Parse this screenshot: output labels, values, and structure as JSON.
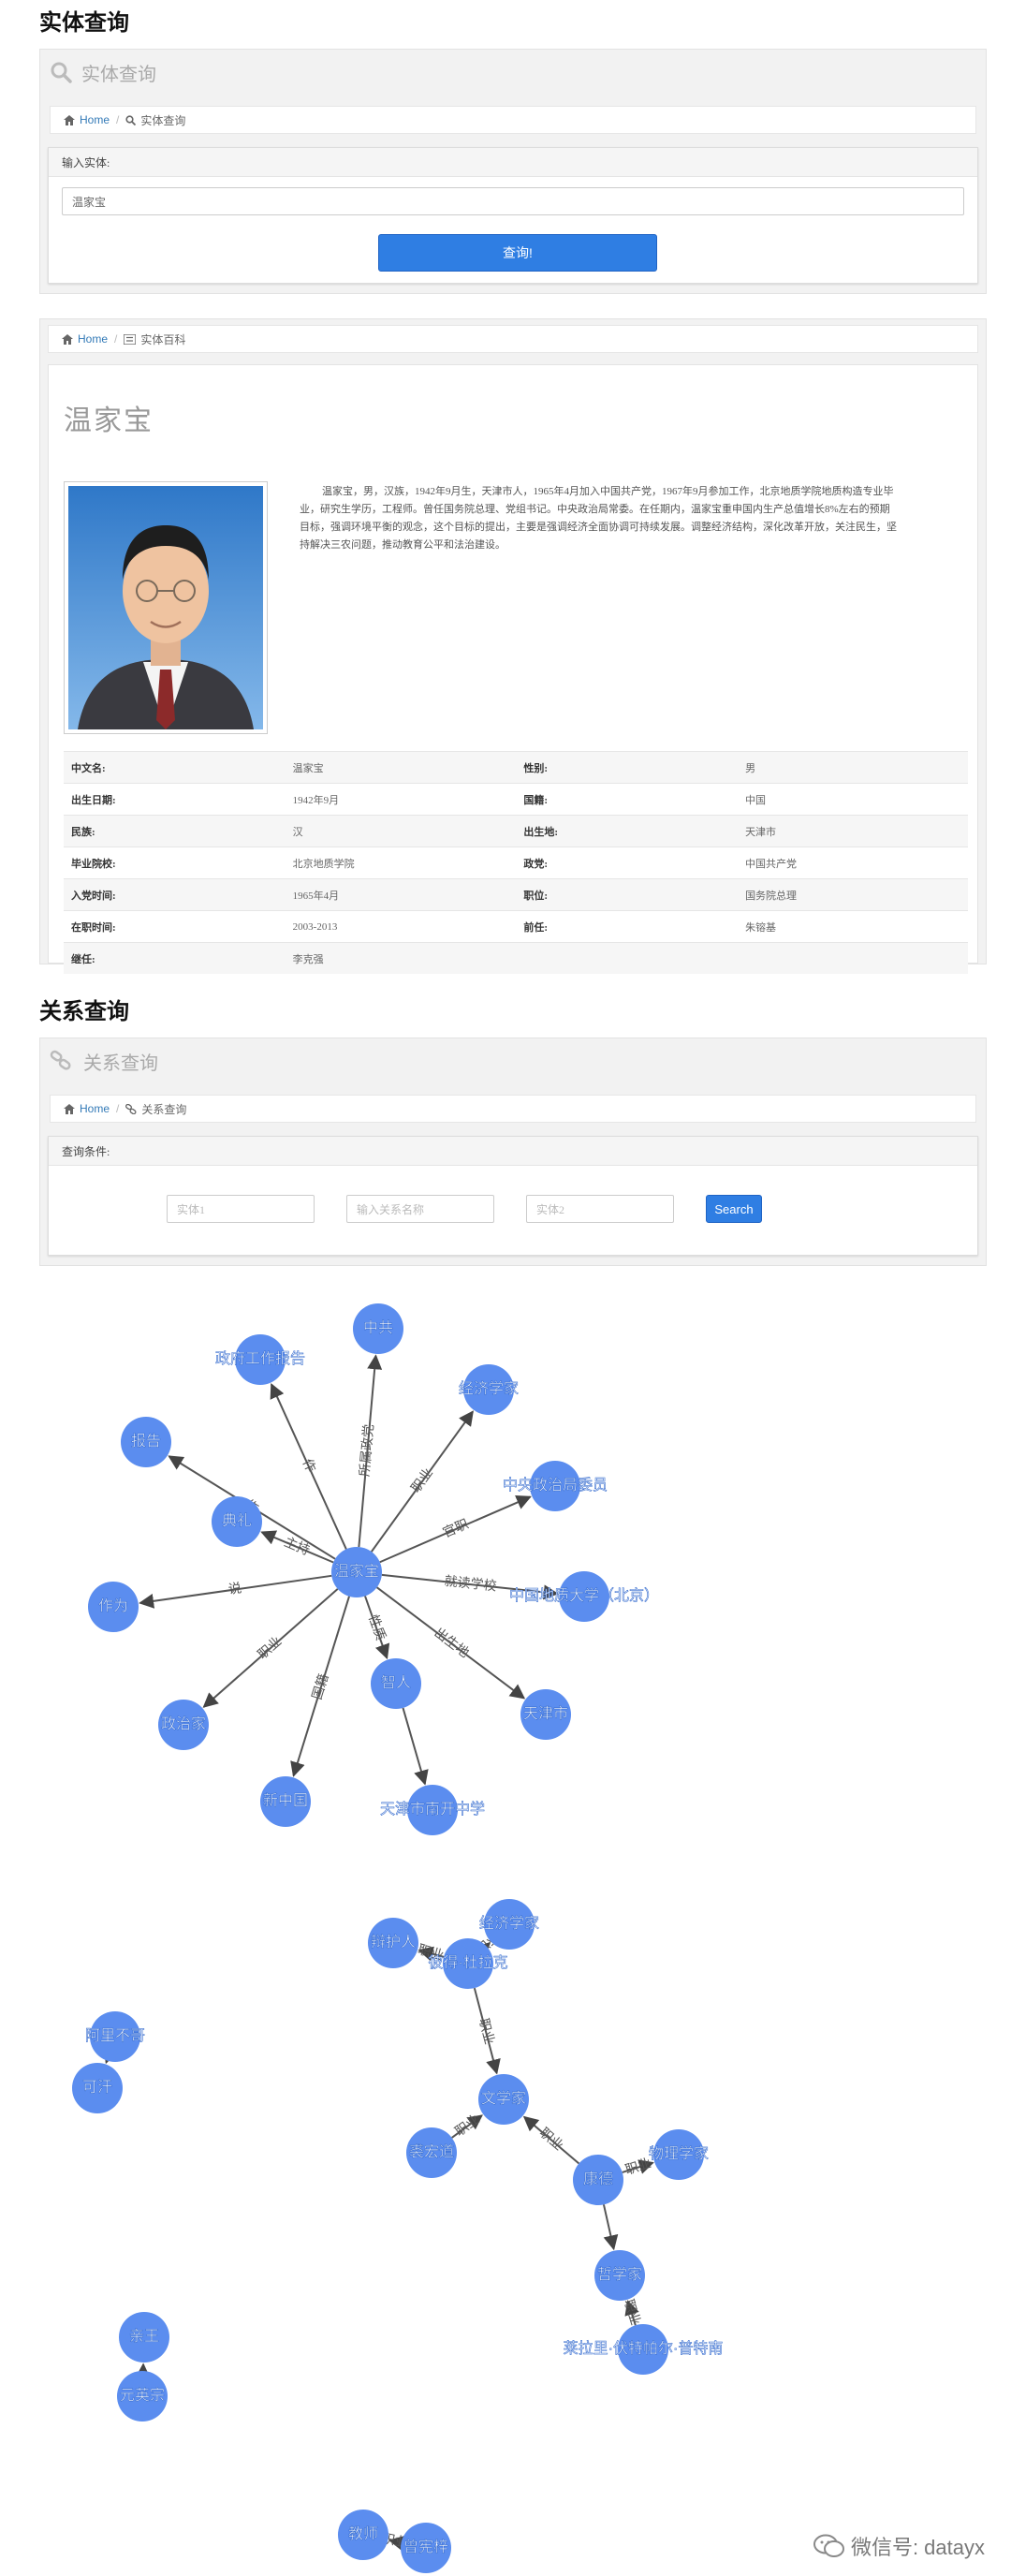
{
  "entity_section": {
    "title": "实体查询",
    "panel_title": "实体查询",
    "breadcrumb": {
      "home": "Home",
      "current": "实体查询"
    },
    "form_label": "输入实体:",
    "input_value": "温家宝",
    "submit_label": "查询!"
  },
  "entity_card": {
    "breadcrumb": {
      "home": "Home",
      "current": "实体百科"
    },
    "name": "温家宝",
    "bio": "温家宝，男，汉族，1942年9月生，天津市人，1965年4月加入中国共产党，1967年9月参加工作，北京地质学院地质构造专业毕业，研究生学历，工程师。曾任国务院总理、党组书记。中央政治局常委。在任期内，温家宝重申国内生产总值增长8%左右的预期目标，强调环境平衡的观念，这个目标的提出，主要是强调经济全面协调可持续发展。调整经济结构，深化改革开放，关注民生，坚持解决三农问题，推动教育公平和法治建设。",
    "info": [
      {
        "k1": "中文名:",
        "v1": "温家宝",
        "k2": "性别:",
        "v2": "男"
      },
      {
        "k1": "出生日期:",
        "v1": "1942年9月",
        "k2": "国籍:",
        "v2": "中国"
      },
      {
        "k1": "民族:",
        "v1": "汉",
        "k2": "出生地:",
        "v2": "天津市"
      },
      {
        "k1": "毕业院校:",
        "v1": "北京地质学院",
        "k2": "政党:",
        "v2": "中国共产党"
      },
      {
        "k1": "入党时间:",
        "v1": "1965年4月",
        "k2": "职位:",
        "v2": "国务院总理"
      },
      {
        "k1": "在职时间:",
        "v1": "2003-2013",
        "k2": "前任:",
        "v2": "朱镕基"
      },
      {
        "k1": "继任:",
        "v1": "李克强",
        "k2": "",
        "v2": ""
      }
    ]
  },
  "relation_section": {
    "title": "关系查询",
    "panel_title": "关系查询",
    "breadcrumb": {
      "home": "Home",
      "current": "关系查询"
    },
    "form_label": "查询条件:",
    "placeholders": {
      "entity1": "实体1",
      "relation": "输入关系名称",
      "entity2": "实体2"
    },
    "search_label": "Search"
  },
  "graph": {
    "node_color": "#5b8def",
    "nodes": [
      {
        "id": "温家宝"
      },
      {
        "id": "中共"
      },
      {
        "id": "政府工作报告"
      },
      {
        "id": "经济学家"
      },
      {
        "id": "报告"
      },
      {
        "id": "中央政治局委员"
      },
      {
        "id": "典礼"
      },
      {
        "id": "中国地质大学（北京）"
      },
      {
        "id": "作为"
      },
      {
        "id": "智人"
      },
      {
        "id": "天津市"
      },
      {
        "id": "政治家"
      },
      {
        "id": "新中国"
      },
      {
        "id": "天津市南开中学"
      },
      {
        "id": "经济学家2",
        "label": "经济学家"
      },
      {
        "id": "辩护人"
      },
      {
        "id": "彼得·杜拉克"
      },
      {
        "id": "阿里不哥"
      },
      {
        "id": "可汗"
      },
      {
        "id": "文学家"
      },
      {
        "id": "裘宏道"
      },
      {
        "id": "康德"
      },
      {
        "id": "物理学家"
      },
      {
        "id": "哲学家"
      },
      {
        "id": "莱拉里·伏特帕尔·普特南"
      },
      {
        "id": "亲王"
      },
      {
        "id": "元英宗"
      },
      {
        "id": "教师"
      },
      {
        "id": "曾宪梓"
      }
    ],
    "edges": [
      {
        "s": "温家宝",
        "t": "中共",
        "label": "所属政党"
      },
      {
        "s": "温家宝",
        "t": "政府工作报告",
        "label": "作"
      },
      {
        "s": "温家宝",
        "t": "经济学家",
        "label": "职业"
      },
      {
        "s": "温家宝",
        "t": "报告",
        "label": "作"
      },
      {
        "s": "温家宝",
        "t": "中央政治局委员",
        "label": "官职"
      },
      {
        "s": "温家宝",
        "t": "典礼",
        "label": "主持"
      },
      {
        "s": "温家宝",
        "t": "中国地质大学（北京）",
        "label": "就读学校"
      },
      {
        "s": "温家宝",
        "t": "作为",
        "label": "说"
      },
      {
        "s": "温家宝",
        "t": "智人",
        "label": "性质"
      },
      {
        "s": "温家宝",
        "t": "天津市",
        "label": "出生地"
      },
      {
        "s": "温家宝",
        "t": "政治家",
        "label": "职业"
      },
      {
        "s": "温家宝",
        "t": "新中国",
        "label": "国籍"
      },
      {
        "s": "智人",
        "t": "天津市南开中学",
        "label": ""
      },
      {
        "s": "彼得·杜拉克",
        "t": "经济学家2",
        "label": "职业"
      },
      {
        "s": "彼得·杜拉克",
        "t": "辩护人",
        "label": "职业"
      },
      {
        "s": "彼得·杜拉克",
        "t": "文学家",
        "label": "职业"
      },
      {
        "s": "阿里不哥",
        "t": "可汗",
        "label": ""
      },
      {
        "s": "裘宏道",
        "t": "文学家",
        "label": "职业"
      },
      {
        "s": "康德",
        "t": "文学家",
        "label": "职业"
      },
      {
        "s": "康德",
        "t": "物理学家",
        "label": "职业"
      },
      {
        "s": "康德",
        "t": "哲学家",
        "label": ""
      },
      {
        "s": "莱拉里·伏特帕尔·普特南",
        "t": "哲学家",
        "label": "职业"
      },
      {
        "s": "元英宗",
        "t": "亲王",
        "label": ""
      },
      {
        "s": "曾宪梓",
        "t": "教师",
        "label": "职业"
      }
    ]
  },
  "watermark": "微信号: datayx"
}
